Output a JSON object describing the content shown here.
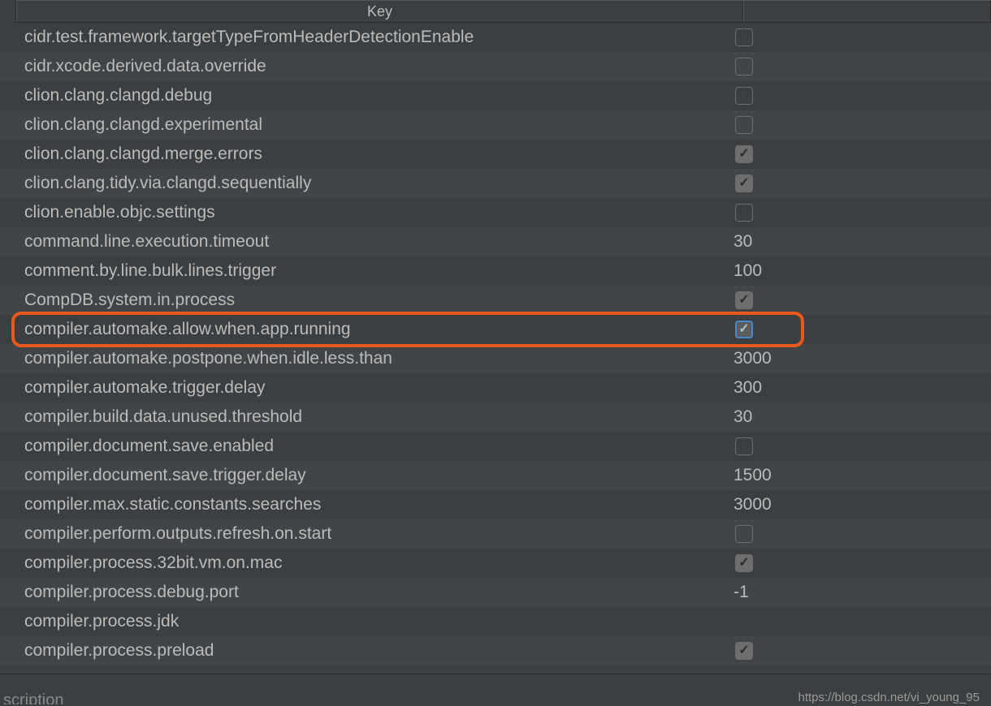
{
  "header": {
    "key_label": "Key",
    "value_label": ""
  },
  "rows": [
    {
      "key": "cidr.test.framework.targetTypeFromHeaderDetectionEnable",
      "type": "checkbox",
      "checked": false
    },
    {
      "key": "cidr.xcode.derived.data.override",
      "type": "checkbox",
      "checked": false
    },
    {
      "key": "clion.clang.clangd.debug",
      "type": "checkbox",
      "checked": false
    },
    {
      "key": "clion.clang.clangd.experimental",
      "type": "checkbox",
      "checked": false
    },
    {
      "key": "clion.clang.clangd.merge.errors",
      "type": "checkbox",
      "checked": true
    },
    {
      "key": "clion.clang.tidy.via.clangd.sequentially",
      "type": "checkbox",
      "checked": true
    },
    {
      "key": "clion.enable.objc.settings",
      "type": "checkbox",
      "checked": false
    },
    {
      "key": "command.line.execution.timeout",
      "type": "text",
      "value": "30"
    },
    {
      "key": "comment.by.line.bulk.lines.trigger",
      "type": "text",
      "value": "100"
    },
    {
      "key": "CompDB.system.in.process",
      "type": "checkbox",
      "checked": true
    },
    {
      "key": "compiler.automake.allow.when.app.running",
      "type": "checkbox",
      "checked": true,
      "highlighted": true
    },
    {
      "key": "compiler.automake.postpone.when.idle.less.than",
      "type": "text",
      "value": "3000"
    },
    {
      "key": "compiler.automake.trigger.delay",
      "type": "text",
      "value": "300"
    },
    {
      "key": "compiler.build.data.unused.threshold",
      "type": "text",
      "value": "30"
    },
    {
      "key": "compiler.document.save.enabled",
      "type": "checkbox",
      "checked": false
    },
    {
      "key": "compiler.document.save.trigger.delay",
      "type": "text",
      "value": "1500"
    },
    {
      "key": "compiler.max.static.constants.searches",
      "type": "text",
      "value": "3000"
    },
    {
      "key": "compiler.perform.outputs.refresh.on.start",
      "type": "checkbox",
      "checked": false
    },
    {
      "key": "compiler.process.32bit.vm.on.mac",
      "type": "checkbox",
      "checked": true
    },
    {
      "key": "compiler.process.debug.port",
      "type": "text",
      "value": "-1"
    },
    {
      "key": "compiler.process.jdk",
      "type": "text",
      "value": ""
    },
    {
      "key": "compiler.process.preload",
      "type": "checkbox",
      "checked": true
    }
  ],
  "bottom": {
    "partial_text": "scription",
    "watermark": "https://blog.csdn.net/vi_young_95"
  }
}
